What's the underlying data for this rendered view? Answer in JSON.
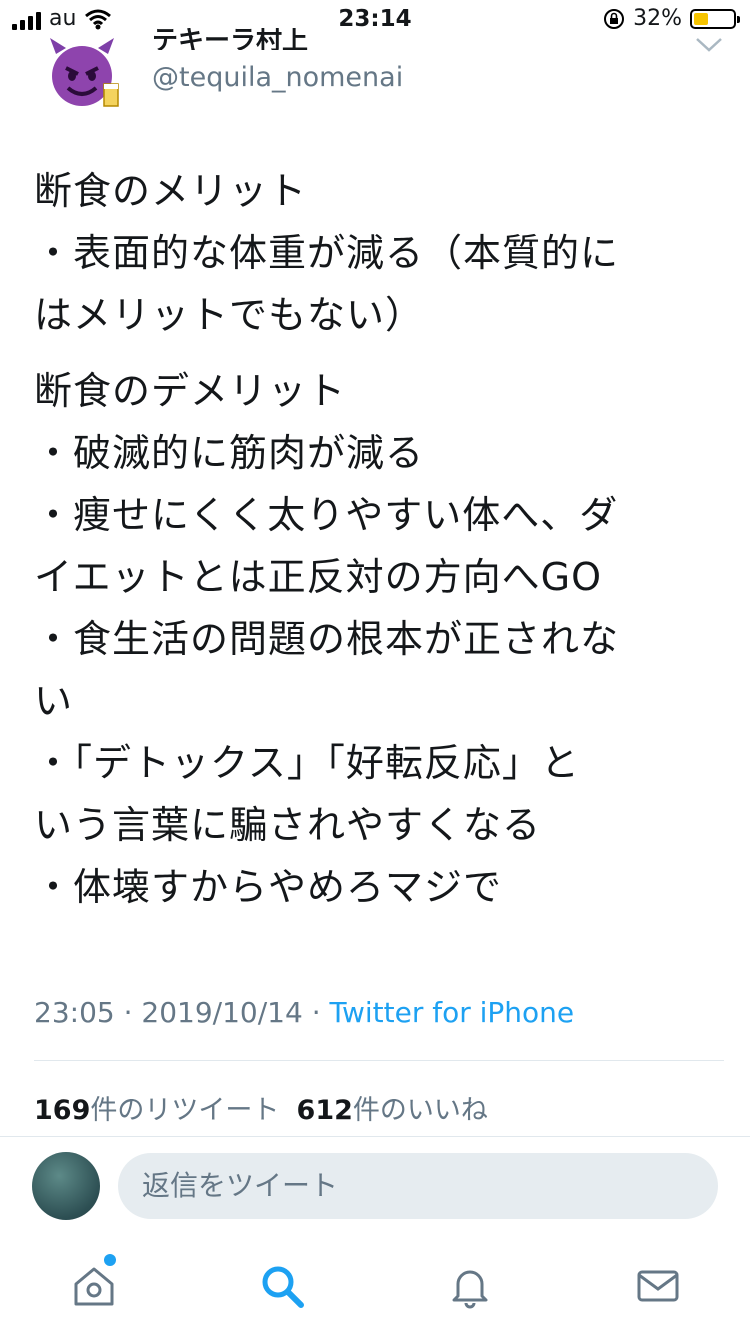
{
  "status_bar": {
    "carrier": "au",
    "time": "23:14",
    "battery": "32%"
  },
  "header": {
    "display_name": "テキーラ村上",
    "handle": "@tequila_nomenai"
  },
  "tweet": {
    "paragraphs": [
      [
        "断食のメリット",
        "・表面的な体重が減る（本質的に",
        "はメリットでもない）"
      ],
      [
        "断食のデメリット",
        "・破滅的に筋肉が減る",
        "・痩せにくく太りやすい体へ、ダ",
        "イエットとは正反対の方向へGO",
        "・食生活の問題の根本が正されな",
        "い",
        "・「デトックス」「好転反応」と",
        "いう言葉に騙されやすくなる",
        "・体壊すからやめろマジで"
      ]
    ],
    "time": "23:05",
    "sep": " · ",
    "date": "2019/10/14",
    "source": "Twitter for iPhone"
  },
  "stats": {
    "retweets": "169",
    "retweets_label": "件のリツイート",
    "likes": "612",
    "likes_label": "件のいいね"
  },
  "reply": {
    "placeholder": "返信をツイート"
  },
  "tabbar": {
    "icons": [
      "home-icon",
      "search-icon",
      "notifications-icon",
      "messages-icon"
    ],
    "active": "search-icon",
    "accent": "#1da1f2"
  }
}
